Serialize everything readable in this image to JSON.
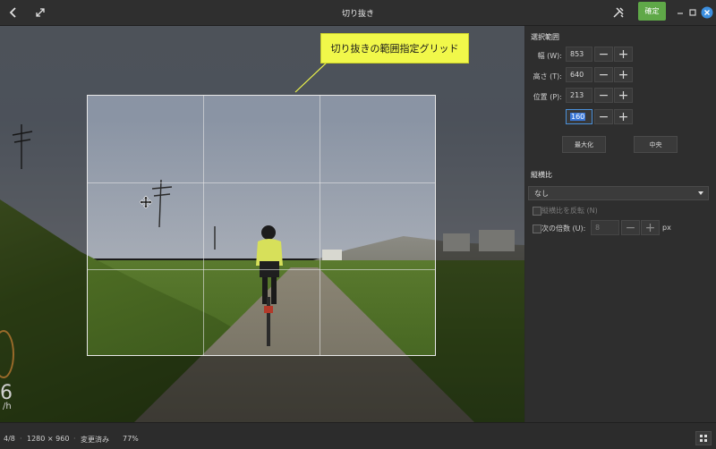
{
  "window": {
    "title": "切り抜き",
    "confirm_label": "確定"
  },
  "annotation": {
    "callout": "切り抜きの範囲指定グリッド"
  },
  "overlay": {
    "dial_value": "6",
    "dial_unit": "/h"
  },
  "sidebar": {
    "selection_title": "選択範囲",
    "fields": {
      "width_label": "幅 (W):",
      "width_value": "853",
      "height_label": "高さ (T):",
      "height_value": "640",
      "pos_label": "位置 (P):",
      "pos_x": "213",
      "pos_y": "160"
    },
    "maximize_label": "最大化",
    "center_label": "中央",
    "aspect_title": "縦横比",
    "aspect_value": "なし",
    "invert_label": "縦横比を反転 (N)",
    "multiple_label": "次の倍数 (U):",
    "multiple_value": "8",
    "multiple_unit": "px"
  },
  "status": {
    "index": "4/8",
    "dimensions": "1280 × 960",
    "modified": "変更済み",
    "zoom": "77%"
  },
  "icons": [
    "back-icon",
    "fullscreen-icon",
    "tools-icon",
    "minimize-icon",
    "maximize-icon",
    "close-icon",
    "move-cursor-icon",
    "grid-view-icon",
    "dropdown-arrow-icon"
  ],
  "colors": {
    "confirm": "#5fa848",
    "callout": "#f1f84a",
    "close": "#3b8fe0",
    "selection": "#3b78d8"
  }
}
